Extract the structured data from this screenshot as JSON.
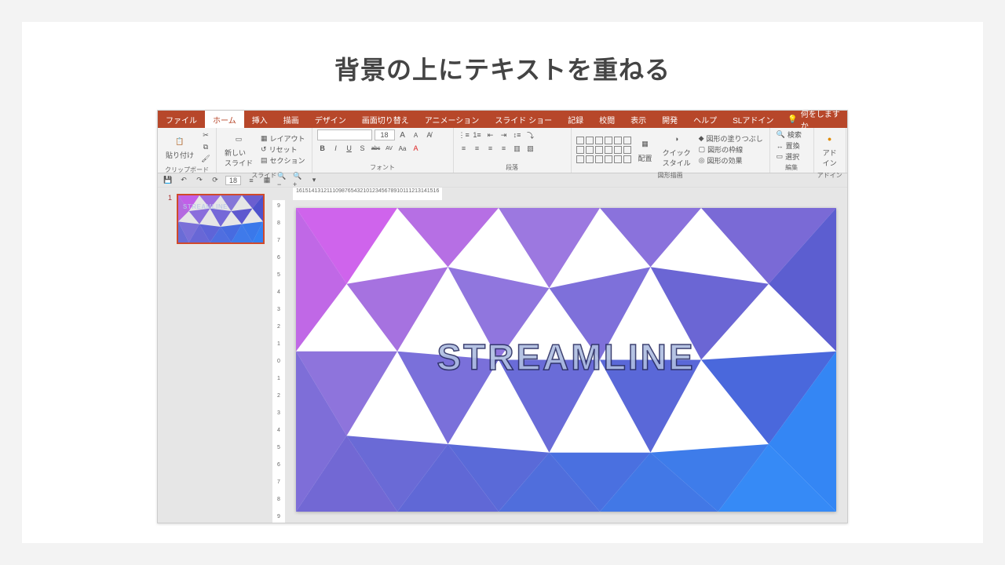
{
  "page": {
    "title": "背景の上にテキストを重ねる"
  },
  "tabs": {
    "file": "ファイル",
    "home": "ホーム",
    "insert": "挿入",
    "draw": "描画",
    "design": "デザイン",
    "transitions": "画面切り替え",
    "animations": "アニメーション",
    "slideshow": "スライド ショー",
    "record": "記録",
    "review": "校閲",
    "view": "表示",
    "developer": "開発",
    "help": "ヘルプ",
    "sladdins": "SLアドイン",
    "tell": "何をしますか"
  },
  "ribbon": {
    "clipboard": {
      "paste": "貼り付け",
      "group": "クリップボード"
    },
    "slides": {
      "new": "新しい\nスライド",
      "layout": "レイアウト",
      "reset": "リセット",
      "section": "セクション",
      "group": "スライド"
    },
    "font": {
      "size": "18",
      "group": "フォント",
      "b": "B",
      "i": "I",
      "u": "U",
      "s": "S",
      "abc": "abc",
      "av": "AV",
      "aa": "Aa",
      "a_big": "A",
      "a_small": "A"
    },
    "paragraph": {
      "group": "段落"
    },
    "drawing": {
      "arrange": "配置",
      "quick": "クイック\nスタイル",
      "fill": "図形の塗りつぶし",
      "outline": "図形の枠線",
      "effects": "図形の効果",
      "group": "図形描画"
    },
    "editing": {
      "find": "検索",
      "replace": "置換",
      "select": "選択",
      "group": "編集"
    },
    "addins": {
      "label": "アド\nイン",
      "group": "アドイン"
    }
  },
  "qat": {
    "fontsize": "18"
  },
  "thumb": {
    "num": "1",
    "text": "STREAMLINE"
  },
  "ruler_h": [
    "16",
    "15",
    "14",
    "13",
    "12",
    "11",
    "10",
    "9",
    "8",
    "7",
    "6",
    "5",
    "4",
    "3",
    "2",
    "1",
    "0",
    "1",
    "2",
    "3",
    "4",
    "5",
    "6",
    "7",
    "8",
    "9",
    "10",
    "11",
    "12",
    "13",
    "14",
    "15",
    "16"
  ],
  "ruler_v": [
    "9",
    "8",
    "7",
    "6",
    "5",
    "4",
    "3",
    "2",
    "1",
    "0",
    "1",
    "2",
    "3",
    "4",
    "5",
    "6",
    "7",
    "8",
    "9"
  ],
  "slide": {
    "headline": "STREAMLINE"
  }
}
